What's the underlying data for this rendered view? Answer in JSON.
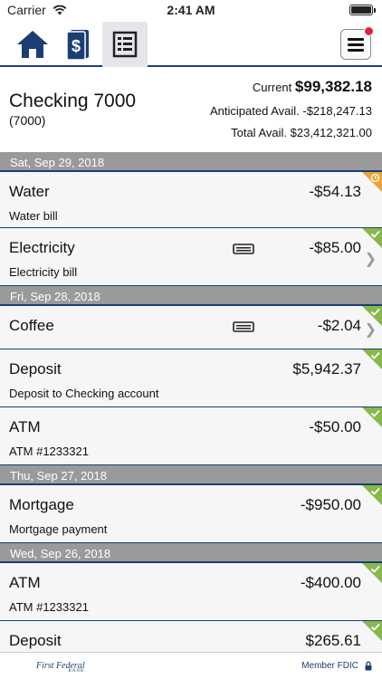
{
  "status": {
    "carrier": "Carrier",
    "time": "2:41 AM"
  },
  "toolbar": {
    "tabs": [
      "home-icon",
      "money-icon",
      "ledger-icon"
    ],
    "active_tab": "ledger-icon",
    "menu_icon": "hamburger-menu-icon",
    "notification": true
  },
  "account": {
    "name": "Checking 7000",
    "number": "(7000)",
    "current_label": "Current",
    "current_value": "$99,382.18",
    "anticipated": "Anticipated Avail. -$218,247.13",
    "total": "Total Avail. $23,412,321.00"
  },
  "groups": [
    {
      "date": "Sat, Sep 29, 2018",
      "items": [
        {
          "title": "Water",
          "memo": "Water bill",
          "amount": "-$54.13",
          "status": "pending",
          "receipt": false,
          "chevron": false
        },
        {
          "title": "Electricity",
          "memo": "Electricity bill",
          "amount": "-$85.00",
          "status": "cleared",
          "receipt": true,
          "chevron": true
        }
      ]
    },
    {
      "date": "Fri, Sep 28, 2018",
      "items": [
        {
          "title": "Coffee",
          "memo": "",
          "amount": "-$2.04",
          "status": "cleared",
          "receipt": true,
          "chevron": true
        },
        {
          "title": "Deposit",
          "memo": "Deposit to Checking account",
          "amount": "$5,942.37",
          "status": "cleared",
          "receipt": false,
          "chevron": false
        },
        {
          "title": "ATM",
          "memo": "ATM #1233321",
          "amount": "-$50.00",
          "status": "cleared",
          "receipt": false,
          "chevron": false
        }
      ]
    },
    {
      "date": "Thu, Sep 27, 2018",
      "items": [
        {
          "title": "Mortgage",
          "memo": "Mortgage payment",
          "amount": "-$950.00",
          "status": "cleared",
          "receipt": false,
          "chevron": false
        }
      ]
    },
    {
      "date": "Wed, Sep 26, 2018",
      "items": [
        {
          "title": "ATM",
          "memo": "ATM #1233321",
          "amount": "-$400.00",
          "status": "cleared",
          "receipt": false,
          "chevron": false
        },
        {
          "title": "Deposit",
          "memo": "",
          "amount": "$265.61",
          "status": "cleared",
          "receipt": false,
          "chevron": false
        }
      ]
    }
  ],
  "footer": {
    "logo": "First Federal",
    "logo_sub": "BANK",
    "fdic": "Member FDIC"
  },
  "colors": {
    "navy": "#1b3f73",
    "cleared": "#86b94a",
    "pending": "#e8a33a",
    "notification": "#e0243b"
  }
}
